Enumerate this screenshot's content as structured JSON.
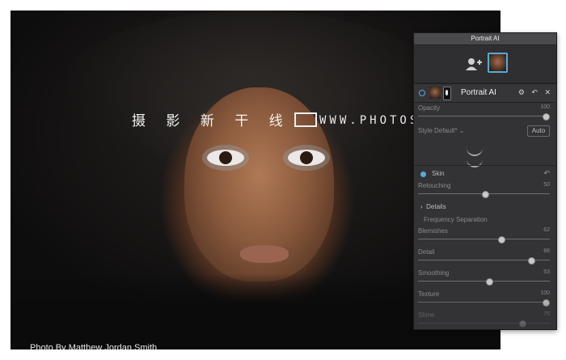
{
  "photo": {
    "watermark_cn": "摄 影 新 干 线",
    "watermark_url": "WWW.PHOTOSKS.VIP",
    "credit": "Photo By Matthew Jordan Smith"
  },
  "panel": {
    "title": "Portrait AI",
    "filter": {
      "name": "Portrait AI",
      "icons": "⚙ ↶ ✕"
    },
    "opacity": {
      "label": "Opacity",
      "value": "100"
    },
    "style": {
      "label": "Style",
      "selected": "Default*",
      "auto_label": "Auto"
    },
    "skin": {
      "label": "Skin"
    },
    "retouching": {
      "label": "Retouching",
      "value": "50"
    },
    "details_label": "Details",
    "frequency_label": "Frequency Separation",
    "blemishes": {
      "label": "Blemishes",
      "value": "62"
    },
    "detail": {
      "label": "Detail",
      "value": "86"
    },
    "smoothing": {
      "label": "Smoothing",
      "value": "53"
    },
    "texture": {
      "label": "Texture",
      "value": "100"
    },
    "shine": {
      "label": "Shine",
      "value": "75"
    }
  },
  "colors": {
    "accent": "#5aa9d6",
    "panel_bg": "#333335"
  }
}
